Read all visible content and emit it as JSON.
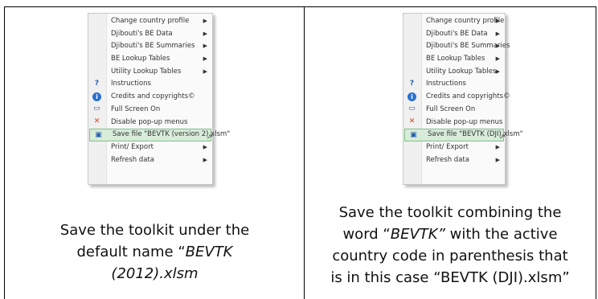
{
  "left": {
    "menu": {
      "items": [
        {
          "label": "Change country profile",
          "arrow": true,
          "icon": ""
        },
        {
          "label": "Djibouti's BE Data",
          "arrow": true,
          "icon": ""
        },
        {
          "label": "Djibouti's BE Summaries",
          "arrow": true,
          "icon": ""
        },
        {
          "label": "BE Lookup Tables",
          "arrow": true,
          "icon": ""
        },
        {
          "label": "Utility Lookup Tables",
          "arrow": true,
          "icon": ""
        },
        {
          "label": "Instructions",
          "arrow": false,
          "icon": "help-icon"
        },
        {
          "label": "Credits and copyrights©",
          "arrow": false,
          "icon": "info-icon"
        },
        {
          "label": "Full Screen On",
          "arrow": false,
          "icon": "screen-icon"
        },
        {
          "label": "Disable pop-up menus",
          "arrow": false,
          "icon": "disable-menu-icon"
        },
        {
          "label": "Save file \"BEVTK (version 2).xlsm\"",
          "arrow": false,
          "icon": "save-icon",
          "highlight": true
        },
        {
          "label": "Print/ Export",
          "arrow": true,
          "icon": ""
        },
        {
          "label": "Refresh data",
          "arrow": true,
          "icon": ""
        }
      ]
    },
    "caption": {
      "line1": "Save the toolkit under the",
      "line2_pre": "default name “",
      "line2_italic": "BEVTK",
      "line3_italic": "(2012).xlsm"
    }
  },
  "right": {
    "menu": {
      "items": [
        {
          "label": "Change country profile",
          "arrow": true,
          "icon": ""
        },
        {
          "label": "Djibouti's BE Data",
          "arrow": true,
          "icon": ""
        },
        {
          "label": "Djibouti's BE Summaries",
          "arrow": true,
          "icon": ""
        },
        {
          "label": "BE Lookup Tables",
          "arrow": true,
          "icon": ""
        },
        {
          "label": "Utility Lookup Tables",
          "arrow": true,
          "icon": ""
        },
        {
          "label": "Instructions",
          "arrow": false,
          "icon": "help-icon"
        },
        {
          "label": "Credits and copyrights©",
          "arrow": false,
          "icon": "info-icon"
        },
        {
          "label": "Full Screen On",
          "arrow": false,
          "icon": "screen-icon"
        },
        {
          "label": "Disable pop-up menus",
          "arrow": false,
          "icon": "disable-menu-icon"
        },
        {
          "label": "Save file \"BEVTK (DJI).xlsm\"",
          "arrow": false,
          "icon": "save-icon",
          "highlight": true
        },
        {
          "label": "Print/ Export",
          "arrow": true,
          "icon": ""
        },
        {
          "label": "Refresh data",
          "arrow": true,
          "icon": ""
        }
      ]
    },
    "caption": {
      "line1": "Save the toolkit combining the",
      "line2_pre": "word “",
      "line2_italic": "BEVTK”",
      "line2_post": " with the active",
      "line3": "country code in parenthesis that",
      "line4": "is in this case “BEVTK (DJI).xlsm”"
    }
  }
}
